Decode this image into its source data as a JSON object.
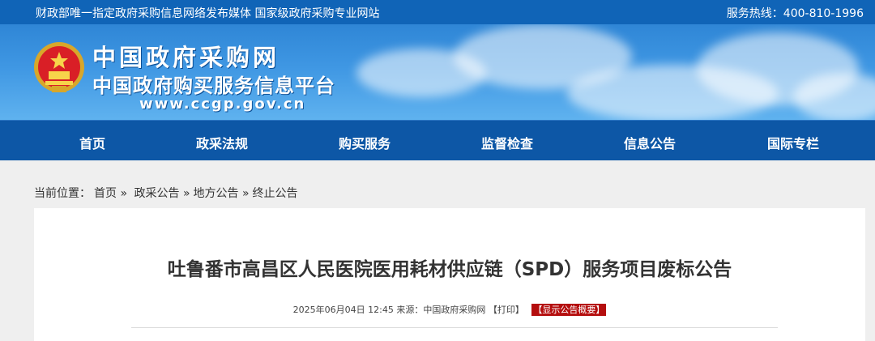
{
  "topbar": {
    "tagline": "财政部唯一指定政府采购信息网络发布媒体 国家级政府采购专业网站",
    "hotline": "服务热线：400-810-1996"
  },
  "header": {
    "site_name": "中国政府采购网",
    "site_subtitle": "中国政府购买服务信息平台",
    "site_url": "www.ccgp.gov.cn",
    "emblem_icon": "national-emblem-icon"
  },
  "nav": {
    "items": [
      {
        "label": "首页"
      },
      {
        "label": "政采法规"
      },
      {
        "label": "购买服务"
      },
      {
        "label": "监督检查"
      },
      {
        "label": "信息公告"
      },
      {
        "label": "国际专栏"
      }
    ]
  },
  "breadcrumb": {
    "prefix": "当前位置：",
    "items": [
      "首页",
      "政采公告",
      "地方公告",
      "终止公告"
    ],
    "separator": "»"
  },
  "article": {
    "title": "吐鲁番市高昌区人民医院医用耗材供应链（SPD）服务项目废标公告",
    "datetime": "2025年06月04日 12:45",
    "source": "来源：中国政府采购网",
    "print_label": "【打印】",
    "summary_label": "【显示公告概要】"
  },
  "colors": {
    "topbar_bg": "#1064b7",
    "nav_bg": "#0d57a6",
    "summary_bg": "#b40e0e"
  }
}
